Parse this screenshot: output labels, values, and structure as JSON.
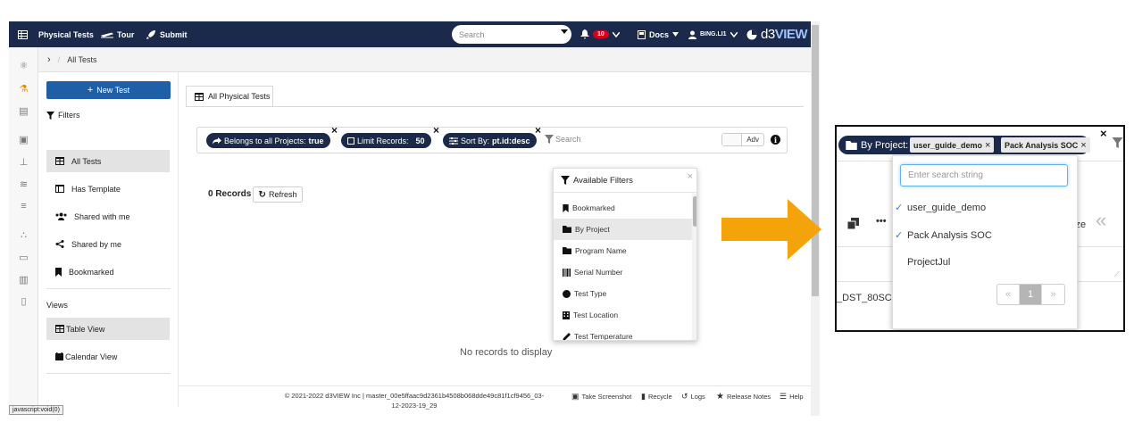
{
  "topbar": {
    "app_title": "Physical Tests",
    "tour_label": "Tour",
    "submit_label": "Submit",
    "search_placeholder": "Search",
    "notification_count": "10",
    "docs_label": "Docs",
    "user_label": "BING.LI1",
    "logo_prefix": "d3",
    "logo_suffix": "VIEW"
  },
  "breadcrumb": {
    "current": "All Tests"
  },
  "sidebar": {
    "new_test_label": "New Test",
    "filters_heading": "Filters",
    "items": [
      {
        "label": "All Tests",
        "icon": "table-icon",
        "active": true
      },
      {
        "label": "Has Template",
        "icon": "template-icon",
        "active": false
      },
      {
        "label": "Shared with me",
        "icon": "users-icon",
        "active": false
      },
      {
        "label": "Shared by me",
        "icon": "share-icon",
        "active": false
      },
      {
        "label": "Bookmarked",
        "icon": "bookmark-icon",
        "active": false
      }
    ],
    "views_heading": "Views",
    "views": [
      {
        "label": "Table View",
        "icon": "table-icon",
        "active": true
      },
      {
        "label": "Calendar View",
        "icon": "calendar-icon",
        "active": false
      }
    ]
  },
  "main": {
    "tab_label": "All Physical Tests",
    "chips": [
      {
        "prefix": "Belongs to all Projects:",
        "value": "true"
      },
      {
        "prefix": "Limit Records:",
        "value": "50"
      },
      {
        "prefix": "Sort By:",
        "value": "pt.id:desc"
      }
    ],
    "filter_search_placeholder": "Search",
    "adv_label": "Adv",
    "records_label": "0 Records",
    "refresh_label": "Refresh",
    "no_records": "No records to display"
  },
  "available_filters": {
    "title": "Available Filters",
    "items": [
      {
        "label": "Bookmarked",
        "icon": "bookmark-icon",
        "highlighted": false
      },
      {
        "label": "By Project",
        "icon": "folder-icon",
        "highlighted": true
      },
      {
        "label": "Program Name",
        "icon": "folder-icon",
        "highlighted": false
      },
      {
        "label": "Serial Number",
        "icon": "barcode-icon",
        "highlighted": false
      },
      {
        "label": "Test Type",
        "icon": "circle-icon",
        "highlighted": false
      },
      {
        "label": "Test Location",
        "icon": "building-icon",
        "highlighted": false
      },
      {
        "label": "Test Temperature",
        "icon": "pencil-icon",
        "highlighted": false
      }
    ]
  },
  "footer": {
    "copyright": "© 2021-2022 d3VIEW Inc | master_00e5ffaac9d2361b4508b068dde49c81f1cf9456_03-12-2023-19_29",
    "links": [
      "Take Screenshot",
      "Recycle",
      "Logs",
      "Release Notes",
      "Help"
    ]
  },
  "status_tip": "javascript:void(0)",
  "zoom": {
    "by_project_label": "By Project:",
    "tags": [
      "user_guide_demo",
      "Pack Analysis SOC"
    ],
    "search_placeholder": "Enter search string",
    "options": [
      {
        "label": "user_guide_demo",
        "checked": true
      },
      {
        "label": "Pack Analysis SOC",
        "checked": true
      },
      {
        "label": "ProjectJul",
        "checked": false
      }
    ],
    "pager": {
      "prev": "«",
      "current": "1",
      "next": "»"
    },
    "partial_ize": "ize",
    "partial_dst": "_DST_80SC",
    "double_chevron": "«"
  },
  "colors": {
    "navbar": "#1b2a4a",
    "primary_button": "#1f5fa8",
    "arrow": "#f5a30a",
    "badge": "#d0021b"
  }
}
